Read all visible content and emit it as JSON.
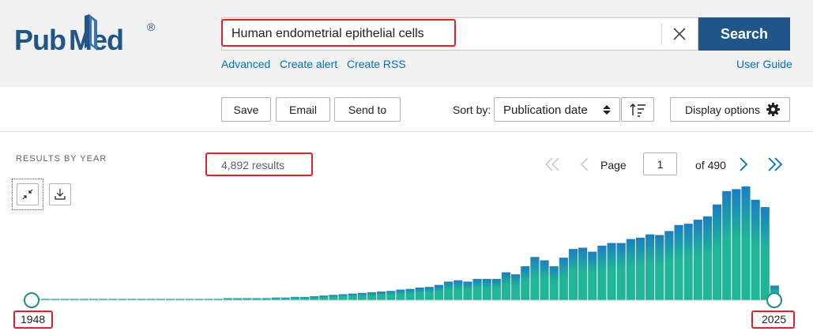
{
  "header": {
    "logo": {
      "text_pub": "Pub",
      "text_med": "Med",
      "registered": "®"
    },
    "search": {
      "value": "Human endometrial epithelial cells",
      "placeholder": ""
    },
    "search_button": "Search",
    "links": {
      "advanced": "Advanced",
      "create_alert": "Create alert",
      "create_rss": "Create RSS",
      "user_guide": "User Guide"
    },
    "colors": {
      "brand": "#20558a",
      "link": "#0071bc",
      "highlight": "#e0212b"
    }
  },
  "toolbar": {
    "save": "Save",
    "email": "Email",
    "send_to": "Send to",
    "sort_label": "Sort by:",
    "sort_value": "Publication date",
    "display_options": "Display options"
  },
  "results": {
    "heading": "RESULTS BY YEAR",
    "count": "4,892 results",
    "page_label": "Page",
    "page_value": "1",
    "of_pages": "of 490"
  },
  "chart_data": {
    "type": "bar",
    "range_start": "1948",
    "range_end": "2025",
    "colors": {
      "bar_top": "#1a7ec2",
      "bar_bottom": "#20b597",
      "handle": "#1f8f87"
    },
    "x": [
      1948,
      1949,
      1950,
      1951,
      1952,
      1953,
      1954,
      1955,
      1956,
      1957,
      1958,
      1959,
      1960,
      1961,
      1962,
      1963,
      1964,
      1965,
      1966,
      1967,
      1968,
      1969,
      1970,
      1971,
      1972,
      1973,
      1974,
      1975,
      1976,
      1977,
      1978,
      1979,
      1980,
      1981,
      1982,
      1983,
      1984,
      1985,
      1986,
      1987,
      1988,
      1989,
      1990,
      1991,
      1992,
      1993,
      1994,
      1995,
      1996,
      1997,
      1998,
      1999,
      2000,
      2001,
      2002,
      2003,
      2004,
      2005,
      2006,
      2007,
      2008,
      2009,
      2010,
      2011,
      2012,
      2013,
      2014,
      2015,
      2016,
      2017,
      2018,
      2019,
      2020,
      2021,
      2022,
      2023,
      2024,
      2025
    ],
    "values": [
      2,
      2,
      2,
      2,
      2,
      2,
      2,
      2,
      2,
      2,
      2,
      2,
      2,
      2,
      2,
      2,
      2,
      2,
      2,
      2,
      3,
      3,
      3,
      3,
      3,
      4,
      4,
      5,
      5,
      6,
      7,
      8,
      9,
      10,
      11,
      12,
      13,
      14,
      16,
      17,
      19,
      20,
      23,
      28,
      30,
      28,
      32,
      32,
      32,
      42,
      39,
      51,
      65,
      60,
      51,
      64,
      77,
      79,
      73,
      82,
      86,
      86,
      92,
      94,
      99,
      98,
      104,
      113,
      115,
      121,
      126,
      144,
      164,
      167,
      171,
      151,
      140,
      22
    ]
  }
}
